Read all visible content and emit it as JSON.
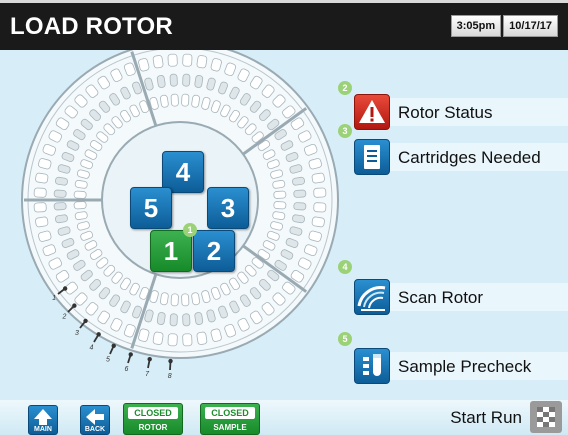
{
  "header": {
    "title": "LOAD ROTOR",
    "time": "3:05pm",
    "date": "10/17/17"
  },
  "rotor": {
    "positions": [
      {
        "number": "1",
        "state": "green"
      },
      {
        "number": "2",
        "state": "blue"
      },
      {
        "number": "3",
        "state": "blue"
      },
      {
        "number": "4",
        "state": "blue"
      },
      {
        "number": "5",
        "state": "blue"
      }
    ],
    "slot_labels": [
      "1",
      "2",
      "3",
      "4",
      "5",
      "6",
      "7",
      "8"
    ]
  },
  "steps": {
    "load": "1",
    "status": "2",
    "cartridges": "3",
    "scan": "4",
    "precheck": "5"
  },
  "actions": {
    "rotor_status": {
      "label": "Rotor Status",
      "icon": "warning-icon"
    },
    "cartridges_needed": {
      "label": "Cartridges Needed",
      "icon": "document-list-icon"
    },
    "scan_rotor": {
      "label": "Scan Rotor",
      "icon": "scan-icon"
    },
    "sample_precheck": {
      "label": "Sample Precheck",
      "icon": "test-tube-icon"
    }
  },
  "bottom": {
    "main_label": "MAIN",
    "back_label": "BACK",
    "rotor_state": "CLOSED",
    "rotor_label": "ROTOR",
    "sample_state": "CLOSED",
    "sample_label": "SAMPLE",
    "start_label": "Start Run"
  },
  "colors": {
    "background": "#d7eef8",
    "header": "#1a1a1a",
    "accent_blue": "#0d5d97",
    "accent_green": "#178a2a",
    "warning_red": "#b21810"
  }
}
